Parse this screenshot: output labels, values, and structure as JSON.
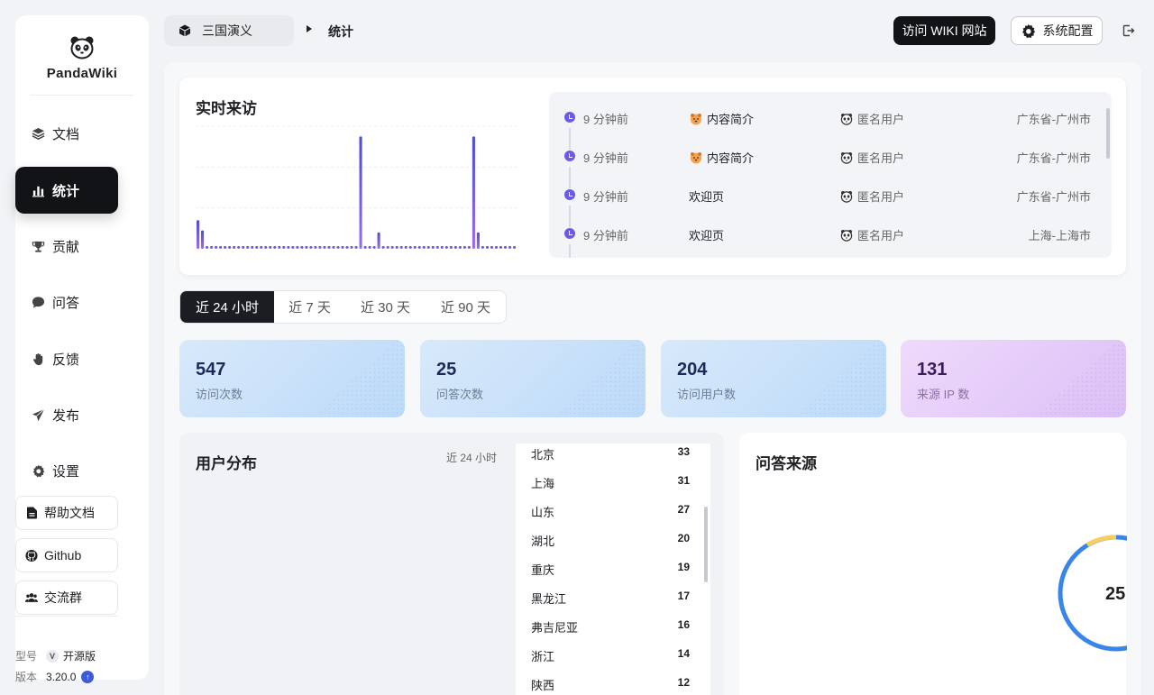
{
  "sidebar": {
    "brand": "PandaWiki",
    "nav": [
      {
        "label": "文档",
        "icon": "layers-icon"
      },
      {
        "label": "统计",
        "icon": "bar-chart-icon"
      },
      {
        "label": "贡献",
        "icon": "trophy-icon"
      },
      {
        "label": "问答",
        "icon": "chat-bubble-icon"
      },
      {
        "label": "反馈",
        "icon": "hand-icon"
      },
      {
        "label": "发布",
        "icon": "send-icon"
      },
      {
        "label": "设置",
        "icon": "gear-icon"
      }
    ],
    "links": [
      {
        "label": "帮助文档",
        "icon": "document-icon"
      },
      {
        "label": "Github",
        "icon": "github-icon"
      },
      {
        "label": "交流群",
        "icon": "group-icon"
      }
    ],
    "model_label": "型号",
    "model_value": "开源版",
    "version_label": "版本",
    "version_value": "3.20.0"
  },
  "topbar": {
    "kb_name": "三国演义",
    "current_page": "统计",
    "visit_wiki": "访问 WIKI 网站",
    "system_config": "系统配置"
  },
  "realtime": {
    "title": "实时来访",
    "visits": [
      {
        "time": "9 分钟前",
        "page": "内容简介",
        "page_emoji": true,
        "user": "匿名用户",
        "location": "广东省-广州市"
      },
      {
        "time": "9 分钟前",
        "page": "内容简介",
        "page_emoji": true,
        "user": "匿名用户",
        "location": "广东省-广州市"
      },
      {
        "time": "9 分钟前",
        "page": "欢迎页",
        "page_emoji": false,
        "user": "匿名用户",
        "location": "广东省-广州市"
      },
      {
        "time": "9 分钟前",
        "page": "欢迎页",
        "page_emoji": false,
        "user": "匿名用户",
        "location": "上海-上海市"
      }
    ]
  },
  "chart_data": {
    "type": "bar",
    "values": [
      14,
      9,
      1,
      1,
      1,
      1,
      1,
      1,
      1,
      1,
      1,
      1,
      1,
      1,
      1,
      1,
      1,
      1,
      1,
      1,
      1,
      1,
      1,
      1,
      1,
      1,
      1,
      1,
      1,
      1,
      1,
      1,
      1,
      1,
      1,
      1,
      55,
      1,
      1,
      1,
      8,
      1,
      1,
      1,
      1,
      1,
      1,
      1,
      1,
      1,
      1,
      1,
      1,
      1,
      1,
      1,
      1,
      1,
      1,
      1,
      1,
      55,
      8,
      1,
      1,
      1,
      1,
      1,
      1,
      1,
      1
    ],
    "ylim": [
      0,
      60
    ],
    "grid": true,
    "colors": [
      "#4b4fd6",
      "#9b6cf0"
    ]
  },
  "ranges": {
    "tabs": [
      "近 24 小时",
      "近 7 天",
      "近 30 天",
      "近 90 天"
    ],
    "active": 0
  },
  "stats": [
    {
      "value": "547",
      "label": "访问次数",
      "theme": "blue"
    },
    {
      "value": "25",
      "label": "问答次数",
      "theme": "blue"
    },
    {
      "value": "204",
      "label": "访问用户数",
      "theme": "blue"
    },
    {
      "value": "131",
      "label": "来源 IP 数",
      "theme": "purple"
    }
  ],
  "distribution": {
    "title": "用户分布",
    "range": "近 24 小时",
    "regions": [
      {
        "name": "北京",
        "count": "33"
      },
      {
        "name": "上海",
        "count": "31"
      },
      {
        "name": "山东",
        "count": "27"
      },
      {
        "name": "湖北",
        "count": "20"
      },
      {
        "name": "重庆",
        "count": "19"
      },
      {
        "name": "黑龙江",
        "count": "17"
      },
      {
        "name": "弗吉尼亚",
        "count": "16"
      },
      {
        "name": "浙江",
        "count": "14"
      },
      {
        "name": "陕西",
        "count": "12"
      }
    ]
  },
  "qa_source": {
    "title": "问答来源",
    "total": "25"
  }
}
